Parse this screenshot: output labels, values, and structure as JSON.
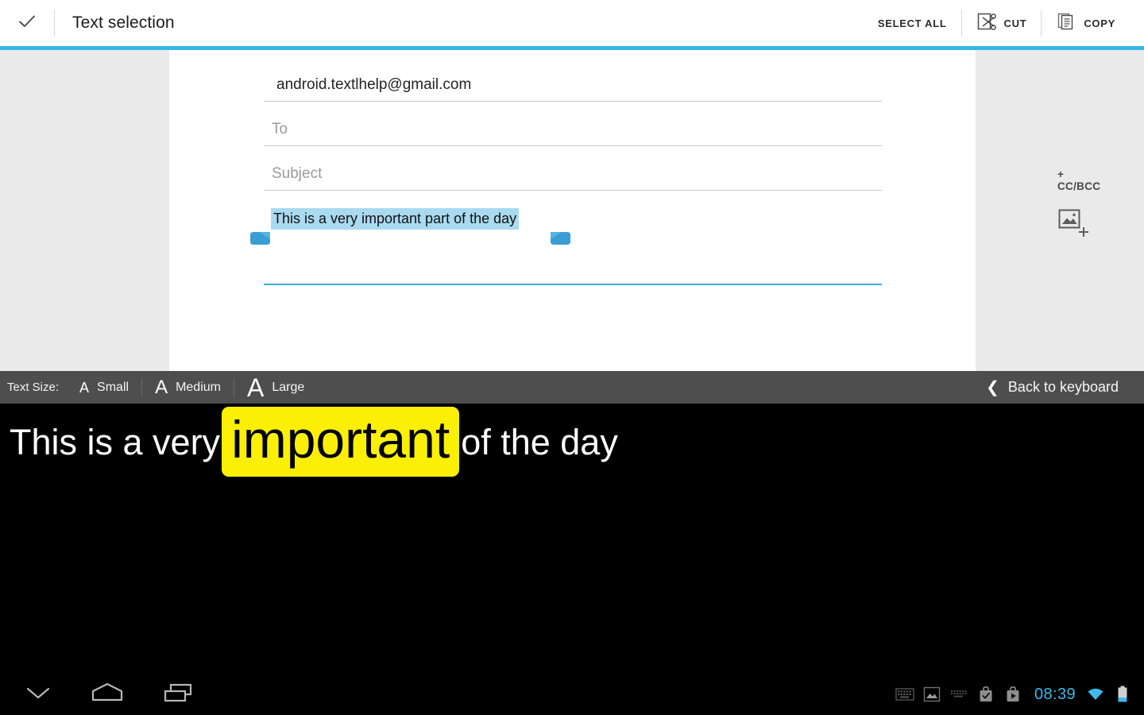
{
  "action_bar": {
    "done_icon": "check-icon",
    "title": "Text selection",
    "actions": [
      {
        "id": "select-all",
        "label": "SELECT ALL",
        "icon": null
      },
      {
        "id": "cut",
        "label": "CUT",
        "icon": "scissors-icon"
      },
      {
        "id": "copy",
        "label": "COPY",
        "icon": "copy-document-icon"
      }
    ],
    "accent_color": "#34b6e4"
  },
  "compose": {
    "from": {
      "value": "android.textlhelp@gmail.com"
    },
    "to": {
      "value": "",
      "placeholder": "To"
    },
    "subject": {
      "value": "",
      "placeholder": "Subject"
    },
    "body": {
      "value": "This is a very important part of the day",
      "selected": true
    },
    "cc_bcc_label": "+ CC/BCC",
    "attach_icon": "insert-image-icon",
    "selection_highlight_color": "#a9daf0",
    "focused_underline_color": "#3bacd8",
    "handle_color": "#3a9ed4"
  },
  "text_size_bar": {
    "label": "Text Size:",
    "options": [
      {
        "id": "small",
        "glyph": "A",
        "label": "Small"
      },
      {
        "id": "medium",
        "glyph": "A",
        "label": "Medium"
      },
      {
        "id": "large",
        "glyph": "A",
        "label": "Large"
      }
    ],
    "back": {
      "icon": "chevron-left-icon",
      "label": "Back to keyboard"
    },
    "background_color": "#4e4e4e"
  },
  "reader": {
    "prefix": "This is a very ",
    "highlight": "important",
    "suffix": "of the day",
    "highlight_color": "#fbf005",
    "text_color": "#ffffff",
    "background_color": "#000000"
  },
  "navigation": {
    "buttons": [
      {
        "id": "back",
        "icon": "chevron-down-icon"
      },
      {
        "id": "home",
        "icon": "home-icon"
      },
      {
        "id": "recents",
        "icon": "recent-apps-icon"
      }
    ]
  },
  "status_bar": {
    "icons": [
      "keyboard-icon",
      "screenshot-image-icon",
      "keyboard-small-icon",
      "bag-check-icon",
      "bag-play-icon"
    ],
    "clock": "08:39",
    "wifi_icon": "wifi-icon",
    "battery_icon": "battery-icon",
    "clock_color": "#3fb9e8"
  }
}
